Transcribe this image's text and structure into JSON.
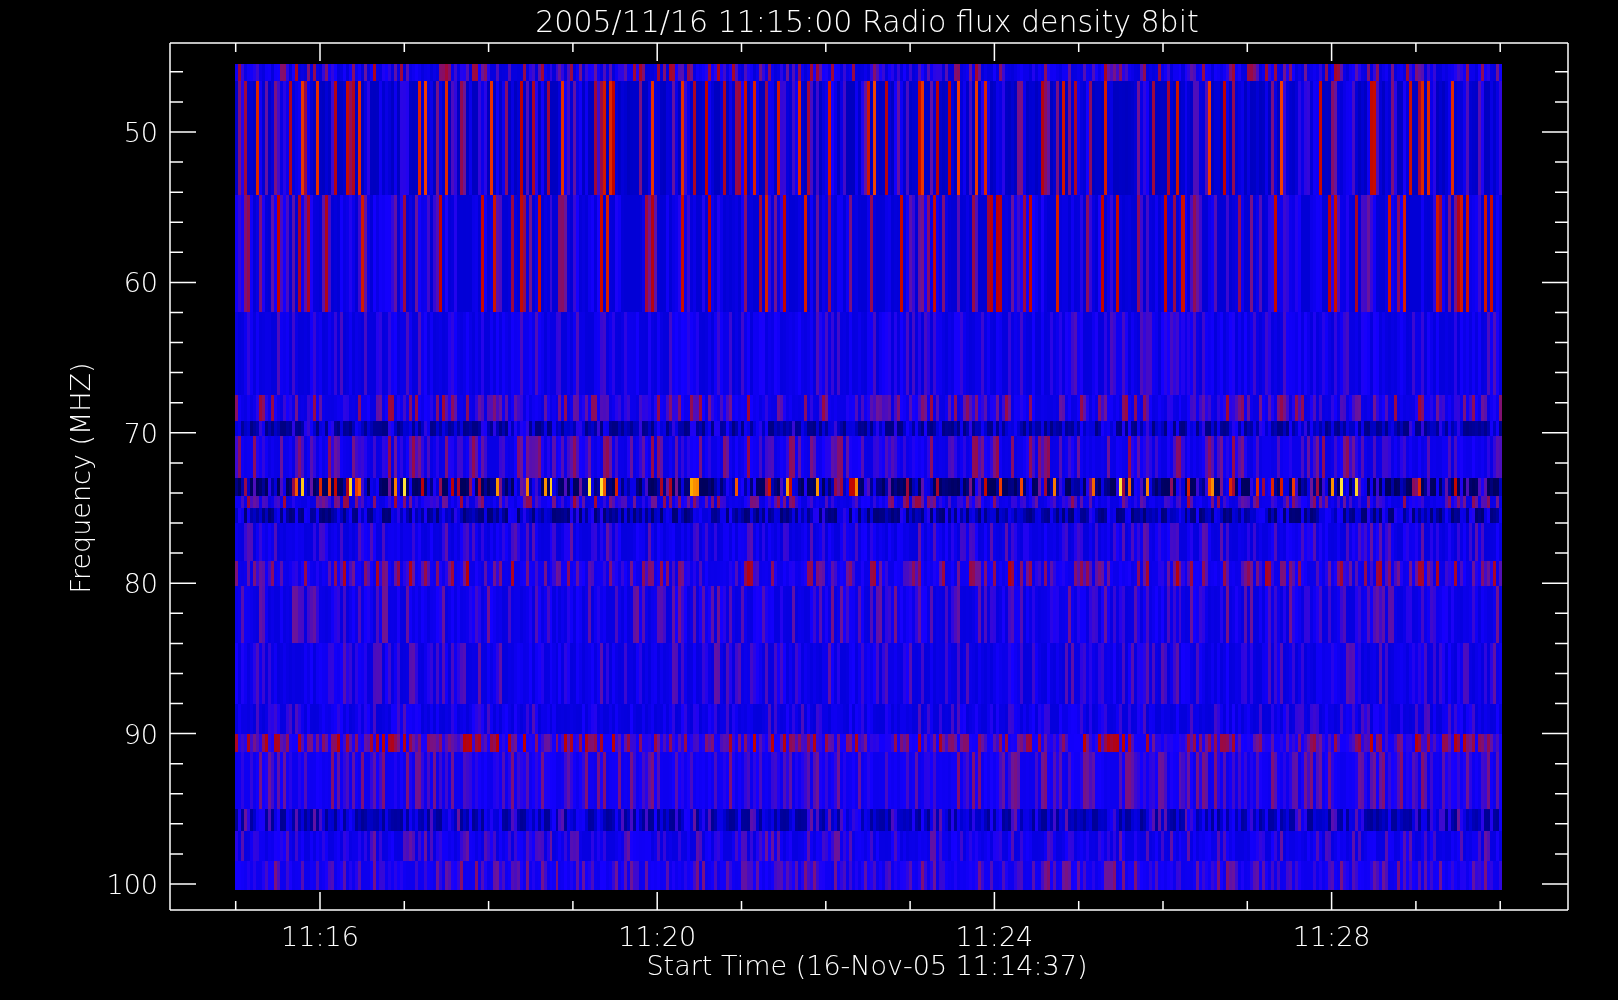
{
  "plot": {
    "title": "2005/11/16 11:15:00 Radio flux density 8bit",
    "ylabel": "Frequency (MHZ)",
    "xlabel": "Start Time (16-Nov-05 11:14:37)",
    "y_tick_labels": [
      "50",
      "60",
      "70",
      "80",
      "90",
      "100"
    ],
    "x_tick_labels": [
      "11:16",
      "11:20",
      "11:24",
      "11:28"
    ]
  }
}
